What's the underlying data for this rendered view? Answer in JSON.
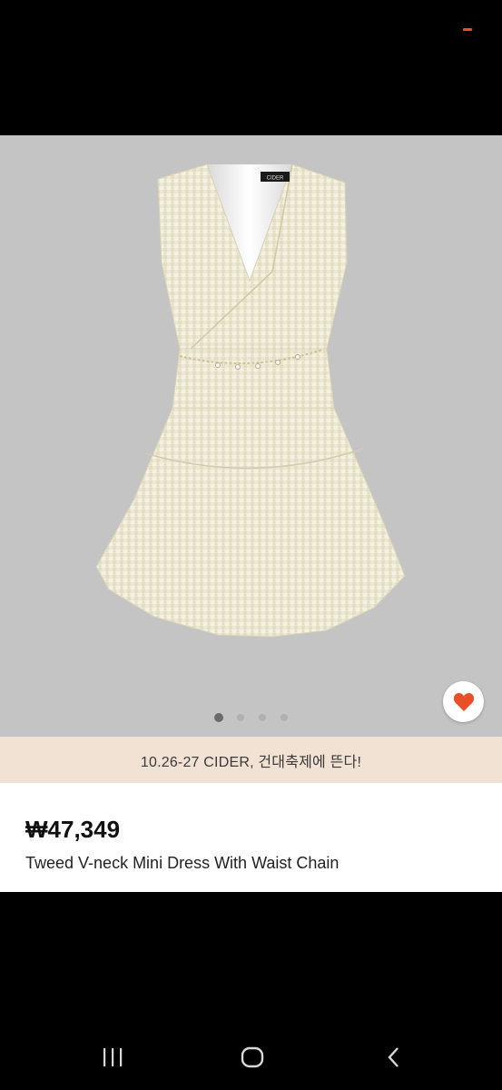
{
  "gallery": {
    "image_alt": "Tweed V-neck Mini Dress With Waist Chain",
    "brand_label": "CIDER",
    "page_count": 4,
    "active_index": 0,
    "favorite_active": true
  },
  "promo": {
    "text": "10.26-27 CIDER, 건대축제에 뜬다!"
  },
  "product": {
    "price": "₩47,349",
    "name": "Tweed V-neck Mini Dress With Waist Chain"
  },
  "colors": {
    "accent": "#e8502a",
    "promo_bg": "#f2e2d3",
    "gallery_bg": "#c4c4c4"
  },
  "system_nav": {
    "recent_icon": "recent-apps-icon",
    "home_icon": "home-icon",
    "back_icon": "back-icon"
  }
}
